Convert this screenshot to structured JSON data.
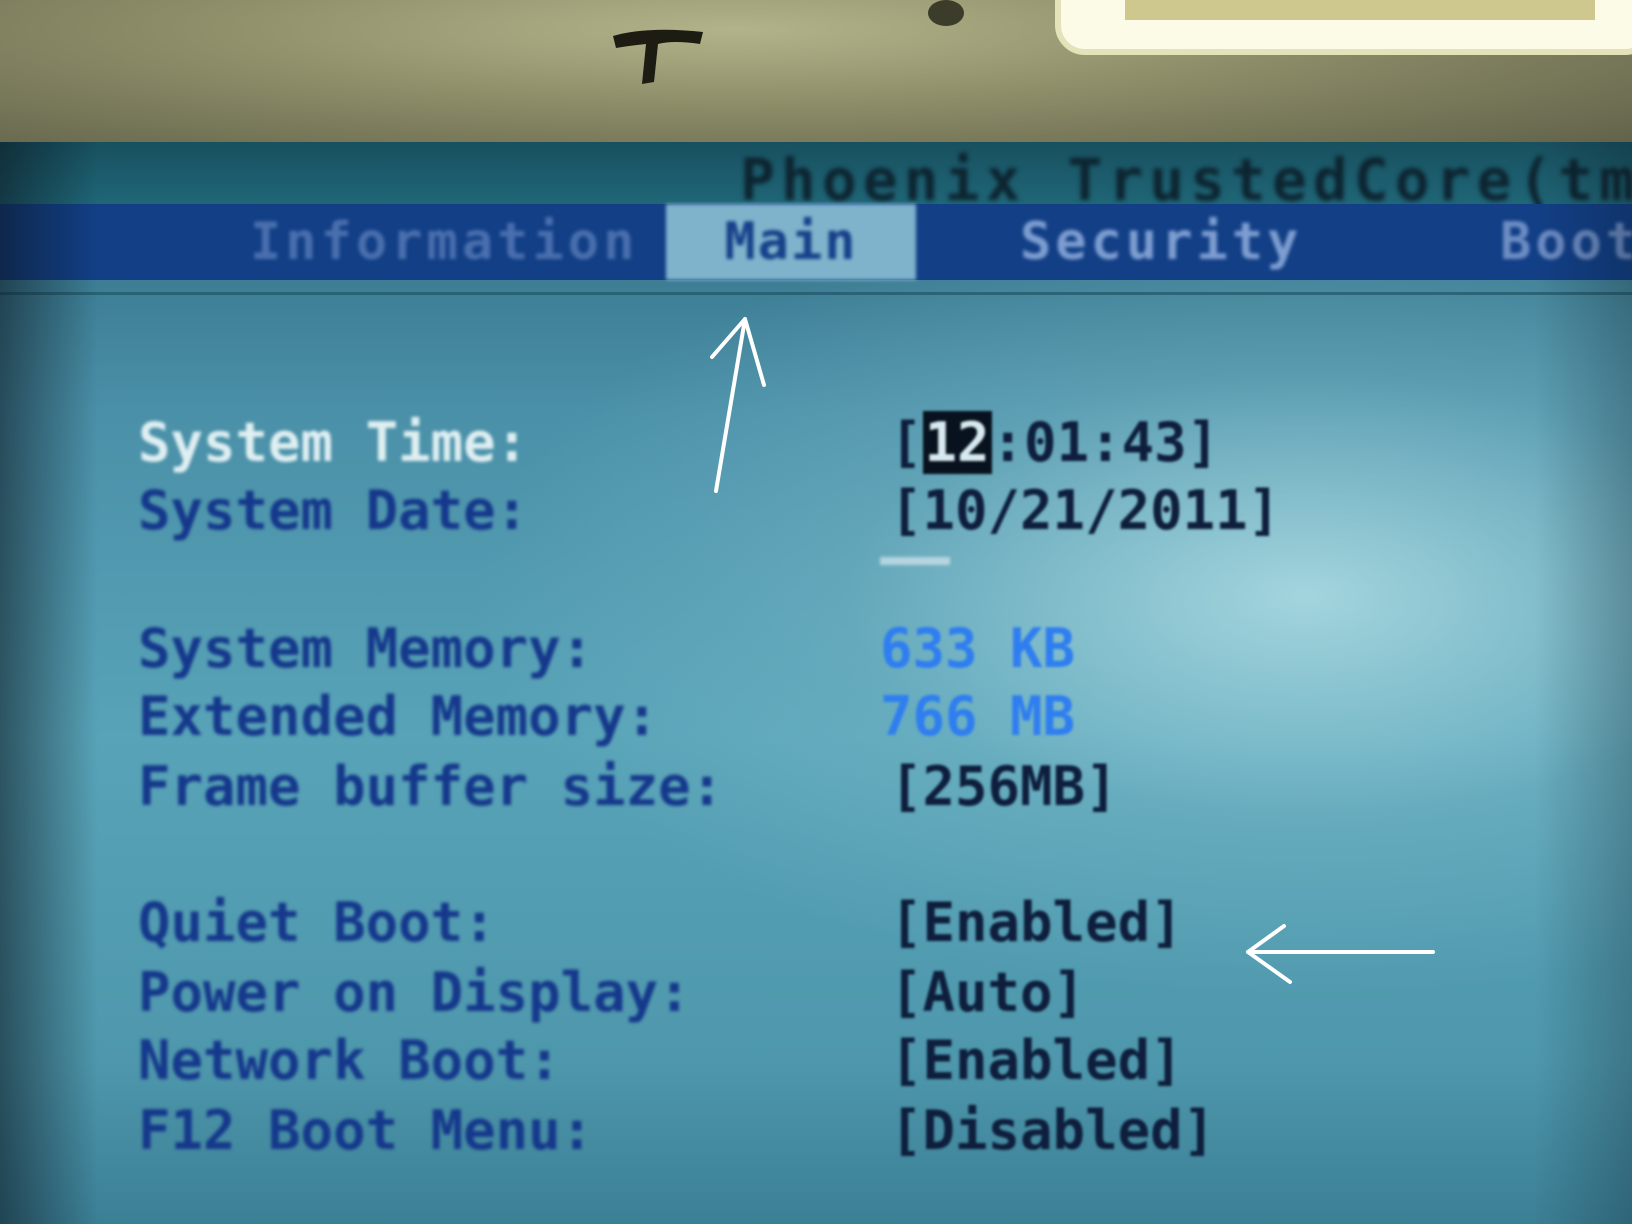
{
  "bios": {
    "title": "Phoenix TrustedCore(tm)",
    "tabs": [
      {
        "label": "Information",
        "active": false
      },
      {
        "label": "Main",
        "active": true
      },
      {
        "label": "Security",
        "active": false
      },
      {
        "label": "Boot",
        "active": false
      }
    ],
    "main": {
      "system_time": {
        "label": "System Time:",
        "value_open": "[",
        "hour": "12",
        "rest": ":01:43]"
      },
      "system_date": {
        "label": "System Date:",
        "value": "[10/21/2011]"
      },
      "system_memory": {
        "label": "System Memory:",
        "value": "633 KB"
      },
      "extended_memory": {
        "label": "Extended Memory:",
        "value": "766 MB"
      },
      "frame_buffer": {
        "label": "Frame buffer size:",
        "value": "[256MB]"
      },
      "quiet_boot": {
        "label": "Quiet Boot:",
        "value": "[Enabled]"
      },
      "power_on_display": {
        "label": "Power on Display:",
        "value": "[Auto]"
      },
      "network_boot": {
        "label": "Network Boot:",
        "value": "[Enabled]"
      },
      "f12_boot_menu": {
        "label": "F12 Boot Menu:",
        "value": "[Disabled]"
      }
    }
  },
  "colors": {
    "screen_background": "#58a3b8",
    "menu_bar": "#123f86",
    "active_tab": "#7fb3cb",
    "label_text": "#15388b",
    "selected_label_text": "#dfeff2",
    "info_value_text": "#2f7ef0",
    "value_text": "#0e1e3c",
    "annotation_arrow": "#ffffff"
  },
  "icons": {
    "tab_arrow": "arrow-up-icon",
    "quiet_boot_arrow": "arrow-left-icon"
  }
}
